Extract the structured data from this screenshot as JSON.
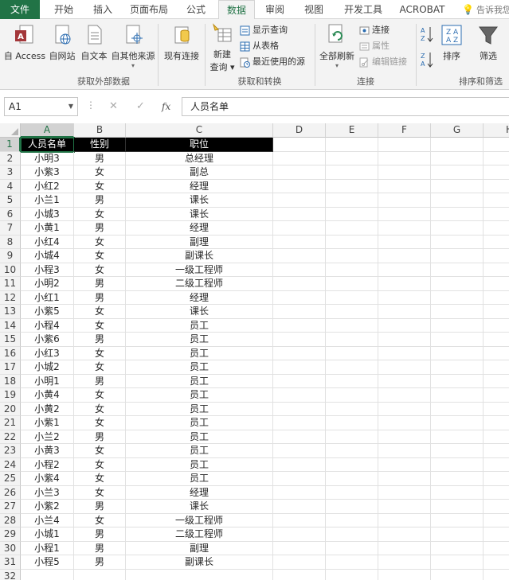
{
  "tabs": [
    {
      "label": "文件",
      "kind": "file"
    },
    {
      "label": "开始"
    },
    {
      "label": "插入"
    },
    {
      "label": "页面布局"
    },
    {
      "label": "公式"
    },
    {
      "label": "数据",
      "kind": "active"
    },
    {
      "label": "审阅"
    },
    {
      "label": "视图"
    },
    {
      "label": "开发工具"
    },
    {
      "label": "ACROBAT"
    }
  ],
  "tell_me": "告诉我您",
  "ribbon": {
    "group_external": {
      "label": "获取外部数据",
      "access": "自 Access",
      "web": "自网站",
      "text": "自文本",
      "other": "自其他来源",
      "existing": "现有连接"
    },
    "group_transform": {
      "label": "获取和转换",
      "new_query_line1": "新建",
      "new_query_line2": "查询 ▾",
      "show_queries": "显示查询",
      "from_table": "从表格",
      "recent_sources": "最近使用的源"
    },
    "group_connections": {
      "label": "连接",
      "refresh_all": "全部刷新",
      "connections": "连接",
      "properties": "属性",
      "edit_links": "编辑链接"
    },
    "group_sort": {
      "label": "排序和筛选",
      "sort": "排序",
      "filter": "筛选"
    }
  },
  "formula_bar": {
    "name_box": "A1",
    "fx": "fx",
    "cancel": "✕",
    "enter": "✓",
    "content": "人员名单"
  },
  "columns": [
    "A",
    "B",
    "C",
    "D",
    "E",
    "F",
    "G",
    "H"
  ],
  "header_row": [
    "人员名单",
    "性别",
    "职位"
  ],
  "rows": [
    [
      "小明3",
      "男",
      "总经理"
    ],
    [
      "小紫3",
      "女",
      "副总"
    ],
    [
      "小红2",
      "女",
      "经理"
    ],
    [
      "小兰1",
      "男",
      "课长"
    ],
    [
      "小城3",
      "女",
      "课长"
    ],
    [
      "小黄1",
      "男",
      "经理"
    ],
    [
      "小红4",
      "女",
      "副理"
    ],
    [
      "小城4",
      "女",
      "副课长"
    ],
    [
      "小程3",
      "女",
      "一级工程师"
    ],
    [
      "小明2",
      "男",
      "二级工程师"
    ],
    [
      "小红1",
      "男",
      "经理"
    ],
    [
      "小紫5",
      "女",
      "课长"
    ],
    [
      "小程4",
      "女",
      "员工"
    ],
    [
      "小紫6",
      "男",
      "员工"
    ],
    [
      "小红3",
      "女",
      "员工"
    ],
    [
      "小城2",
      "女",
      "员工"
    ],
    [
      "小明1",
      "男",
      "员工"
    ],
    [
      "小黄4",
      "女",
      "员工"
    ],
    [
      "小黄2",
      "女",
      "员工"
    ],
    [
      "小紫1",
      "女",
      "员工"
    ],
    [
      "小兰2",
      "男",
      "员工"
    ],
    [
      "小黄3",
      "女",
      "员工"
    ],
    [
      "小程2",
      "女",
      "员工"
    ],
    [
      "小紫4",
      "女",
      "员工"
    ],
    [
      "小兰3",
      "女",
      "经理"
    ],
    [
      "小紫2",
      "男",
      "课长"
    ],
    [
      "小兰4",
      "女",
      "一级工程师"
    ],
    [
      "小城1",
      "男",
      "二级工程师"
    ],
    [
      "小程1",
      "男",
      "副理"
    ],
    [
      "小程5",
      "男",
      "副课长"
    ]
  ],
  "extra_row_number": "32",
  "colors": {
    "accent": "#217346",
    "header_fill": "#000000"
  }
}
